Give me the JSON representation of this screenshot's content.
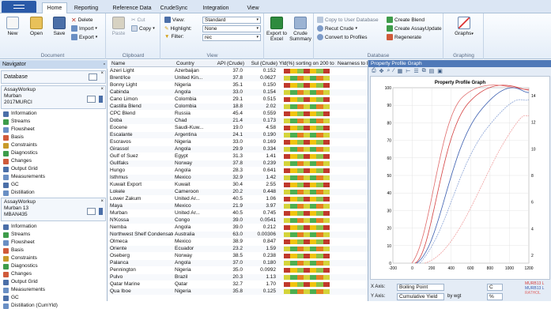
{
  "tabs": {
    "file": "",
    "items": [
      "Home",
      "Reporting",
      "Reference Data",
      "CrudeSync",
      "Integration",
      "View"
    ]
  },
  "ribbon": {
    "document": {
      "label": "Document",
      "new": "New",
      "open": "Open",
      "save": "Save",
      "delete": "Delete",
      "import": "Import",
      "export": "Export"
    },
    "clipboard": {
      "label": "Clipboard",
      "paste": "Paste",
      "cut": "Cut",
      "copy": "Copy"
    },
    "view": {
      "label": "View",
      "view_label": "View:",
      "view_value": "Standard",
      "highlight_label": "Highlight:",
      "highlight_value": "None",
      "filter_label": "Filter:",
      "filter_value": "rec"
    },
    "export": {
      "label": "Export to Excel"
    },
    "crude_summary": {
      "label": "Crude Summary"
    },
    "database": {
      "label": "Database",
      "copy_user": "Copy to User Database",
      "recut": "Recut Crude",
      "convert": "Convert to Profiles",
      "create_blend": "Create Blend",
      "create_assay": "Create AssayUpdate",
      "regenerate": "Regenerate"
    },
    "graphing": {
      "label": "Graphing",
      "graphs": "Graphs"
    }
  },
  "navigator": {
    "title": "Navigator",
    "database_label": "Database",
    "sec1": {
      "title": "AssayWorkup",
      "line1": "Murban",
      "line2": "2017MURCI"
    },
    "items1": [
      "Information",
      "Streams",
      "Flowsheet",
      "Basis",
      "Constraints",
      "Diagnostics",
      "Changes",
      "Output Grid",
      "Measurements",
      "GC",
      "Distillation"
    ],
    "sec2": {
      "title": "AssayWorkup",
      "line1": "Murban 13",
      "line2": "MBAN435"
    },
    "items2": [
      "Information",
      "Streams",
      "Flowsheet",
      "Basis",
      "Constraints",
      "Diagnostics",
      "Changes",
      "Output Grid",
      "Measurements",
      "GC",
      "Distillation (CumYld)"
    ]
  },
  "table": {
    "headers": [
      "Name",
      "Country",
      "API (Crude)",
      "Sul (Crude)",
      "Yld(%) sorting on 200 to 260 C",
      "Nearness to Murodi (Overall)",
      "Yld(%wt) 500C res",
      "Yalcopow)"
    ],
    "rows": [
      [
        "Azeri Light",
        "Azerbaijan",
        "37.0",
        "0.152"
      ],
      [
        "Brent/Ice",
        "United Kin...",
        "37.8",
        "0.0627"
      ],
      [
        "Bonny Light",
        "Nigeria",
        "35.1",
        "0.150"
      ],
      [
        "Cabinda",
        "Angola",
        "33.0",
        "0.154"
      ],
      [
        "Cano Limon",
        "Colombia",
        "29.1",
        "0.515"
      ],
      [
        "Castilla Blend",
        "Colombia",
        "18.8",
        "2.02"
      ],
      [
        "CPC Blend",
        "Russia",
        "45.4",
        "0.559"
      ],
      [
        "Doba",
        "Chad",
        "21.4",
        "0.173"
      ],
      [
        "Eocene",
        "Saudi-Kuw...",
        "19.0",
        "4.58"
      ],
      [
        "Escalante",
        "Argentina",
        "24.1",
        "0.190"
      ],
      [
        "Escravos",
        "Nigeria",
        "33.0",
        "0.169"
      ],
      [
        "Girassol",
        "Angola",
        "29.9",
        "0.334"
      ],
      [
        "Gulf of Suez",
        "Egypt",
        "31.3",
        "1.41"
      ],
      [
        "Gullfaks",
        "Norway",
        "37.8",
        "0.239"
      ],
      [
        "Hungo",
        "Angola",
        "28.3",
        "0.641"
      ],
      [
        "Isthmus",
        "Mexico",
        "32.9",
        "1.42"
      ],
      [
        "Kuwait Export",
        "Kuwait",
        "30.4",
        "2.55"
      ],
      [
        "Lokele",
        "Cameroon",
        "20.2",
        "0.448"
      ],
      [
        "Lower Zakum",
        "United Ar...",
        "40.5",
        "1.06"
      ],
      [
        "Maya",
        "Mexico",
        "21.9",
        "3.97"
      ],
      [
        "Murban",
        "United Ar...",
        "40.5",
        "0.745"
      ],
      [
        "N'Kossa",
        "Congo",
        "39.0",
        "0.0541"
      ],
      [
        "Nemba",
        "Angola",
        "39.0",
        "0.212"
      ],
      [
        "Northwest Shelf Condensate",
        "Australia",
        "63.0",
        "0.00306"
      ],
      [
        "Olmeca",
        "Mexico",
        "38.9",
        "0.847"
      ],
      [
        "Oriente",
        "Ecuador",
        "23.2",
        "1.59"
      ],
      [
        "Oseberg",
        "Norway",
        "38.5",
        "0.238"
      ],
      [
        "Palanca",
        "Angola",
        "37.0",
        "0.180"
      ],
      [
        "Pennington",
        "Nigeria",
        "35.0",
        "0.0992"
      ],
      [
        "Pulvo",
        "Brazil",
        "20.3",
        "1.13"
      ],
      [
        "Qatar Marine",
        "Qatar",
        "32.7",
        "1.70"
      ],
      [
        "Qua Iboe",
        "Nigeria",
        "35.8",
        "0.125"
      ]
    ]
  },
  "graph": {
    "panel_title": "Property Profile Graph",
    "plot_title": "Property Profile Graph",
    "x_ticks": [
      "-200",
      "0",
      "200",
      "400",
      "600",
      "800",
      "1000",
      "1200"
    ],
    "y_left_ticks": [
      "100",
      "90",
      "80",
      "70",
      "60",
      "50",
      "40",
      "30",
      "20",
      "10",
      "0"
    ],
    "y_right_ticks": [
      "14",
      "12",
      "10",
      "8",
      "6",
      "4",
      "2"
    ],
    "xaxis_label": "X Axis:",
    "xaxis_value": "Boiling Point",
    "xaxis_unit": "C",
    "yaxis_label": "Y Axis:",
    "yaxis_value": "Cumulative Yield",
    "yaxis_by": "by wgt",
    "yaxis_unit": "%",
    "legend": [
      "MURB13 L",
      "MURB13 L",
      "RATHOL"
    ]
  }
}
